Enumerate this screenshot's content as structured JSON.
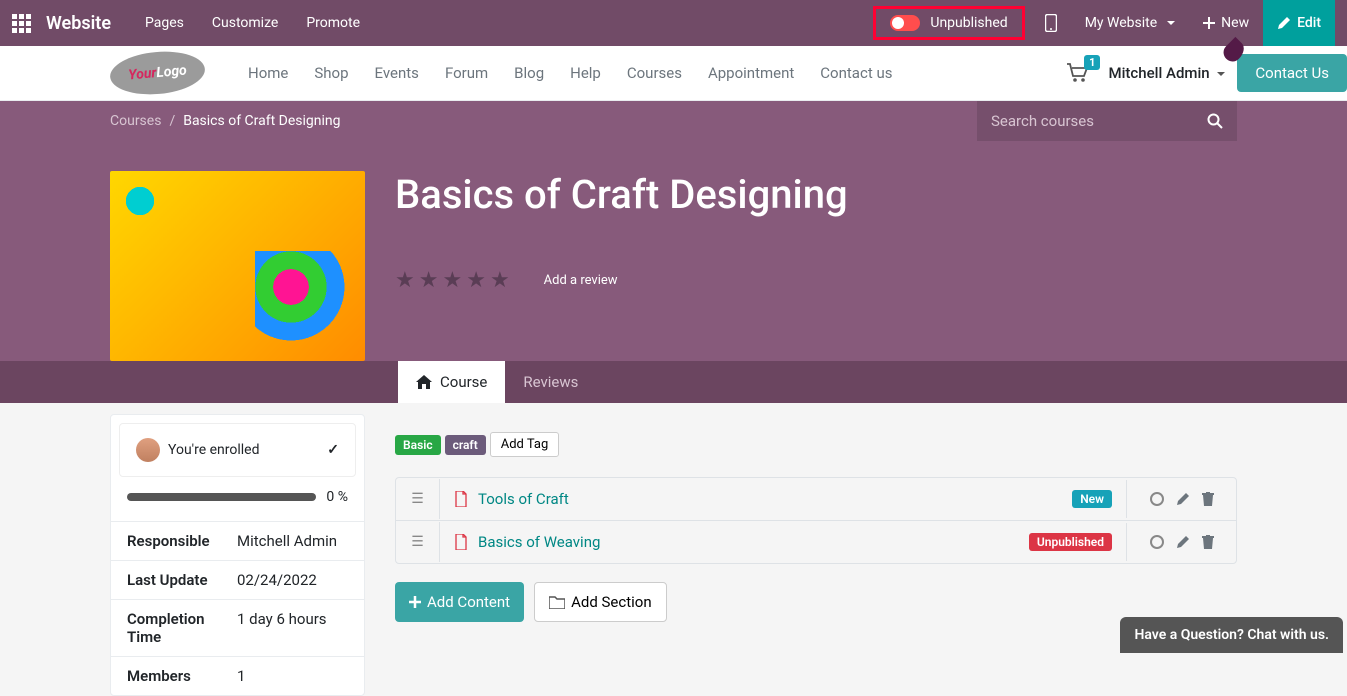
{
  "topbar": {
    "brand": "Website",
    "links": [
      "Pages",
      "Customize",
      "Promote"
    ],
    "publish_label": "Unpublished",
    "my_website": "My Website",
    "new_label": "New",
    "edit_label": "Edit"
  },
  "sitebar": {
    "logo_your": "Your",
    "logo_logo": "Logo",
    "links": [
      "Home",
      "Shop",
      "Events",
      "Forum",
      "Blog",
      "Help",
      "Courses",
      "Appointment",
      "Contact us"
    ],
    "cart_count": "1",
    "user": "Mitchell Admin",
    "contact_label": "Contact Us"
  },
  "breadcrumb": {
    "root": "Courses",
    "current": "Basics of Craft Designing",
    "search_placeholder": "Search courses"
  },
  "hero": {
    "title": "Basics of Craft Designing",
    "add_review": "Add a review"
  },
  "tabs": {
    "course": "Course",
    "reviews": "Reviews"
  },
  "sidebar": {
    "enrolled_text": "You're enrolled",
    "progress_pct": "0 %",
    "rows": [
      {
        "label": "Responsible",
        "value": "Mitchell Admin"
      },
      {
        "label": "Last Update",
        "value": "02/24/2022"
      },
      {
        "label": "Completion Time",
        "value": "1 day 6 hours"
      },
      {
        "label": "Members",
        "value": "1"
      }
    ]
  },
  "content": {
    "tags": {
      "basic": "Basic",
      "craft": "craft",
      "add_tag": "Add Tag"
    },
    "items": [
      {
        "title": "Tools of Craft",
        "status": "New"
      },
      {
        "title": "Basics of Weaving",
        "status": "Unpublished"
      }
    ],
    "add_content": "Add Content",
    "add_section": "Add Section"
  },
  "chat": {
    "label": "Have a Question? Chat with us."
  }
}
